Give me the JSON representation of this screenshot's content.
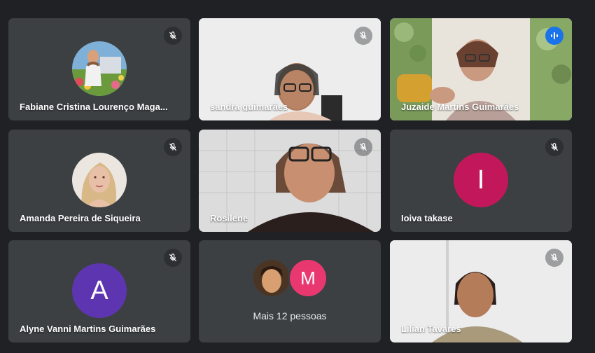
{
  "participants": [
    {
      "name": "Fabiane Cristina Lourenço Maga...",
      "muted": true,
      "type": "avatar-photo"
    },
    {
      "name": "sandra guimarães",
      "muted": true,
      "type": "video"
    },
    {
      "name": "Juzaide Martins Guimarães",
      "muted": false,
      "speaking": true,
      "type": "video"
    },
    {
      "name": "Amanda Pereira de Siqueira",
      "muted": true,
      "type": "avatar-photo"
    },
    {
      "name": "Rosilene",
      "muted": true,
      "type": "video"
    },
    {
      "name": "Ioiva takase",
      "muted": true,
      "type": "avatar-letter",
      "initial": "I",
      "color": "#c2185b"
    },
    {
      "name": "Alyne Vanni Martins Guimarães",
      "muted": true,
      "type": "avatar-letter",
      "initial": "A",
      "color": "#5e35b1"
    },
    {
      "name": "Lilian Tavares",
      "muted": true,
      "type": "video"
    }
  ],
  "overflow": {
    "label": "Mais 12 pessoas",
    "avatar_initial": "M",
    "avatar_color": "#e8386f"
  },
  "colors": {
    "background": "#202124",
    "tile": "#3c4043",
    "speaking_border": "#8ab4f8",
    "speaking_indicator": "#1a73e8"
  },
  "icons": {
    "muted": "mic-off-icon",
    "speaking": "audio-level-icon"
  }
}
